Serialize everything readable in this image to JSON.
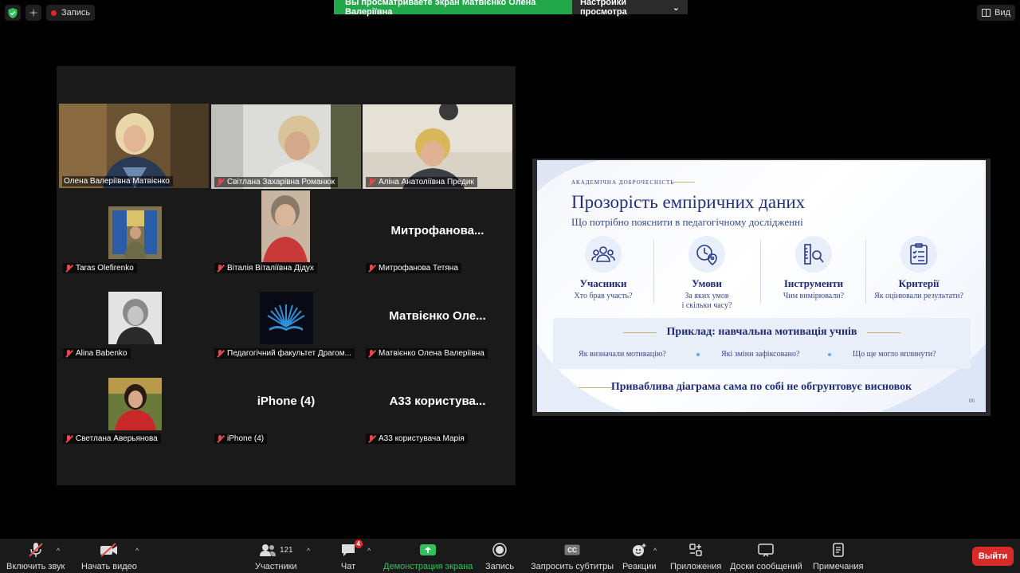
{
  "topbar": {
    "record_label": "Запись",
    "share_banner": "Вы просматриваете экран Матвієнко Олена Валеріївна",
    "view_options": "Настройки просмотра",
    "view_label": "Вид"
  },
  "gallery": {
    "tiles": [
      {
        "name": "Олена Валеріївна Матвієнко",
        "muted": false,
        "active": true
      },
      {
        "name": "Світлана Захарівна Романюк",
        "muted": true
      },
      {
        "name": "Аліна Анатоліївна Предик",
        "muted": true
      },
      {
        "name": "Taras Olefirenko",
        "muted": true
      },
      {
        "name": "Віталія Віталіївна Дідух",
        "muted": true
      },
      {
        "name": "Митрофанова Тетяна",
        "muted": true,
        "display": "Митрофанова..."
      },
      {
        "name": "Alina Babenko",
        "muted": true
      },
      {
        "name": "Педагогічний факультет Драгом...",
        "muted": true
      },
      {
        "name": "Матвієнко Олена Валеріївна",
        "muted": true,
        "display": "Матвієнко Оле..."
      },
      {
        "name": "Светлана Аверьянова",
        "muted": true
      },
      {
        "name": "iPhone (4)",
        "muted": true,
        "display": "iPhone (4)"
      },
      {
        "name": "А33 користувача Марія",
        "muted": true,
        "display": "А33 користува..."
      }
    ]
  },
  "slide": {
    "kicker": "АКАДЕМІЧНА ДОБРОЧЕСНІСТЬ",
    "title": "Прозорість емпіричних даних",
    "subtitle": "Що потрібно пояснити в педагогічному дослідженні",
    "columns": [
      {
        "title": "Учасники",
        "question": "Хто брав участь?",
        "icon": "people-icon"
      },
      {
        "title": "Умови",
        "question": "За яких умов і скільки часу?",
        "question_line1": "За яких умов",
        "question_line2": "і скільки часу?",
        "icon": "clock-pin-icon"
      },
      {
        "title": "Інструменти",
        "question": "Чим вимірювали?",
        "icon": "ruler-magnifier-icon"
      },
      {
        "title": "Критерії",
        "question": "Як оцінювали результати?",
        "icon": "checklist-icon"
      }
    ],
    "example_title": "Приклад: навчальна мотивація учнів",
    "example_questions": [
      "Як визначали мотивацію?",
      "Які зміни зафіксовано?",
      "Що ще могло вплинути?"
    ],
    "conclusion": "Приваблива діаграма сама по собі не обгрунтовує висновок",
    "page": "06"
  },
  "toolbar": {
    "unmute": "Включить звук",
    "start_video": "Начать видео",
    "participants": "Участники",
    "participants_count": "121",
    "chat": "Чат",
    "chat_badge": "4",
    "share_screen": "Демонстрация экрана",
    "record": "Запись",
    "captions": "Запросить субтитры",
    "reactions": "Реакции",
    "apps": "Приложения",
    "whiteboards": "Доски сообщений",
    "notes": "Примечания",
    "leave": "Выйти"
  },
  "colors": {
    "share_green": "#22a74a",
    "active_speaker": "#c6d04a",
    "leave_red": "#d92a2a",
    "slide_navy": "#1e2a78"
  }
}
